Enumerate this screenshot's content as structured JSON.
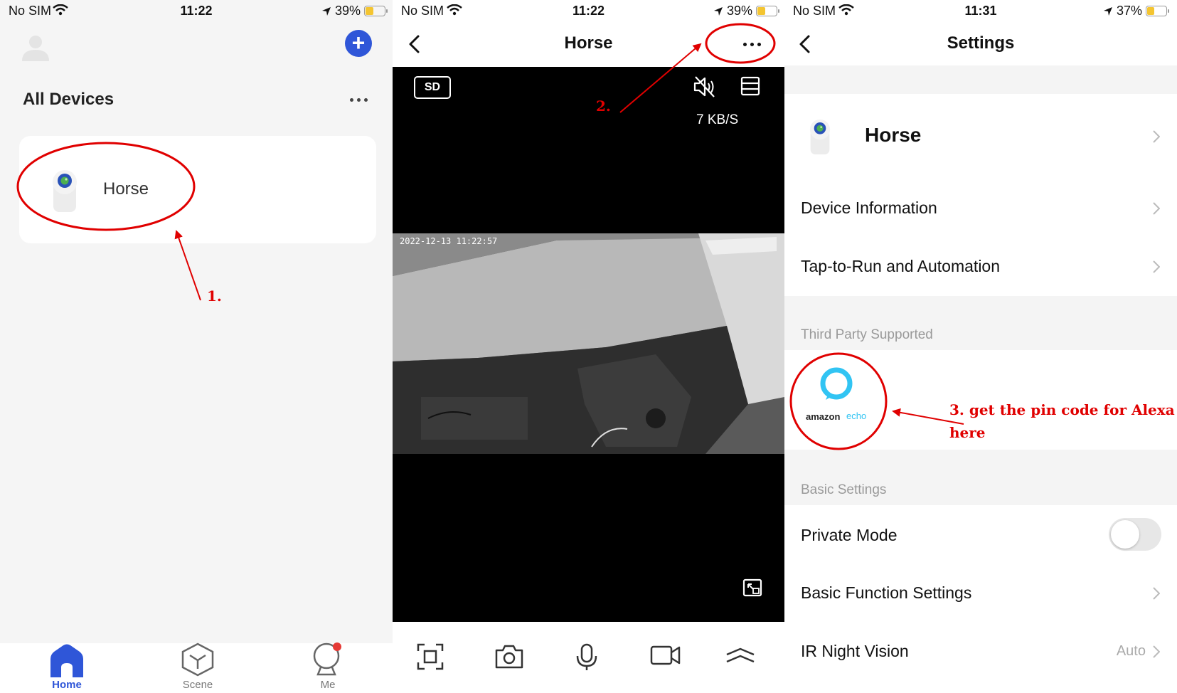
{
  "screen1": {
    "status": {
      "carrier": "No SIM",
      "time": "11:22",
      "battery": "39%"
    },
    "section_title": "All Devices",
    "device": {
      "name": "Horse"
    },
    "tabs": [
      {
        "label": "Home"
      },
      {
        "label": "Scene"
      },
      {
        "label": "Me"
      }
    ]
  },
  "screen2": {
    "status": {
      "carrier": "No SIM",
      "time": "11:22",
      "battery": "39%"
    },
    "title": "Horse",
    "quality_badge": "SD",
    "speed": "7 KB/S",
    "video_timestamp": "2022-12-13  11:22:57"
  },
  "screen3": {
    "status": {
      "carrier": "No SIM",
      "time": "11:31",
      "battery": "37%"
    },
    "title": "Settings",
    "device_name": "Horse",
    "rows": {
      "device_information": "Device Information",
      "tap_to_run": "Tap-to-Run and Automation",
      "private_mode": "Private Mode",
      "basic_function": "Basic Function Settings",
      "ir_night_vision": "IR Night Vision",
      "ir_value": "Auto"
    },
    "private_mode_on": false,
    "sections": {
      "third_party": "Third Party Supported",
      "basic": "Basic Settings"
    },
    "alexa_logo": {
      "brand": "amazon",
      "product": "echo"
    }
  },
  "annotations": {
    "step1": "1.",
    "step2": "2.",
    "step3_line1": "3. get the pin code for Alexa",
    "step3_line2": "here"
  },
  "colors": {
    "accent": "#2f56d8",
    "annotation": "#e00000",
    "battery_fill": "#f4c531",
    "alexa_ring": "#31c4f3"
  }
}
